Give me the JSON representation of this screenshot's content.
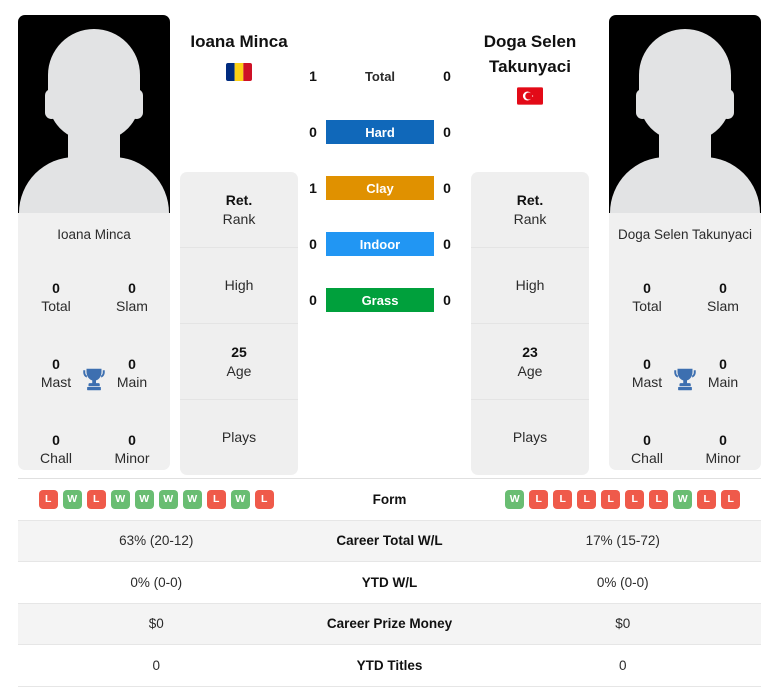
{
  "players": {
    "left": {
      "name": "Ioana Minca",
      "card_name": "Ioana Minca",
      "flag": "romania-flag",
      "titles": {
        "total_val": "0",
        "total_lbl": "Total",
        "slam_val": "0",
        "slam_lbl": "Slam",
        "mast_val": "0",
        "mast_lbl": "Mast",
        "main_val": "0",
        "main_lbl": "Main",
        "chall_val": "0",
        "chall_lbl": "Chall",
        "minor_val": "0",
        "minor_lbl": "Minor"
      },
      "info": {
        "rank_val": "Ret.",
        "rank_lbl": "Rank",
        "high_val": "",
        "high_lbl": "High",
        "age_val": "25",
        "age_lbl": "Age",
        "plays_val": "",
        "plays_lbl": "Plays"
      },
      "form": [
        "L",
        "W",
        "L",
        "W",
        "W",
        "W",
        "W",
        "L",
        "W",
        "L"
      ],
      "career_total_wl": "63% (20-12)",
      "ytd_wl": "0% (0-0)",
      "career_prize_money": "$0",
      "ytd_titles": "0"
    },
    "right": {
      "name": "Doga Selen Takunyaci",
      "card_name": "Doga Selen Takunyaci",
      "flag": "turkey-flag",
      "titles": {
        "total_val": "0",
        "total_lbl": "Total",
        "slam_val": "0",
        "slam_lbl": "Slam",
        "mast_val": "0",
        "mast_lbl": "Mast",
        "main_val": "0",
        "main_lbl": "Main",
        "chall_val": "0",
        "chall_lbl": "Chall",
        "minor_val": "0",
        "minor_lbl": "Minor"
      },
      "info": {
        "rank_val": "Ret.",
        "rank_lbl": "Rank",
        "high_val": "",
        "high_lbl": "High",
        "age_val": "23",
        "age_lbl": "Age",
        "plays_val": "",
        "plays_lbl": "Plays"
      },
      "form": [
        "W",
        "L",
        "L",
        "L",
        "L",
        "L",
        "L",
        "W",
        "L",
        "L"
      ],
      "career_total_wl": "17% (15-72)",
      "ytd_wl": "0% (0-0)",
      "career_prize_money": "$0",
      "ytd_titles": "0"
    }
  },
  "head_to_head": {
    "rows": [
      {
        "label": "Total",
        "left": "1",
        "right": "0",
        "color": "",
        "type": "plain"
      },
      {
        "label": "Hard",
        "left": "0",
        "right": "0",
        "color": "#1068ba",
        "type": "badge"
      },
      {
        "label": "Clay",
        "left": "1",
        "right": "0",
        "color": "#e09100",
        "type": "badge"
      },
      {
        "label": "Indoor",
        "left": "0",
        "right": "0",
        "color": "#2196f3",
        "type": "badge"
      },
      {
        "label": "Grass",
        "left": "0",
        "right": "0",
        "color": "#00a03c",
        "type": "badge"
      }
    ]
  },
  "stats_table": {
    "rows": [
      {
        "label": "Form",
        "key": "form",
        "type": "form",
        "shaded": false
      },
      {
        "label": "Career Total W/L",
        "key": "career_total_wl",
        "type": "text",
        "shaded": true
      },
      {
        "label": "YTD W/L",
        "key": "ytd_wl",
        "type": "text",
        "shaded": false
      },
      {
        "label": "Career Prize Money",
        "key": "career_prize_money",
        "type": "text",
        "shaded": true
      },
      {
        "label": "YTD Titles",
        "key": "ytd_titles",
        "type": "text",
        "shaded": false
      }
    ]
  },
  "colors": {
    "win": "#69bd72",
    "loss": "#ef5a4a",
    "trophy": "#3d6fb0",
    "panel_bg": "#efefef",
    "row_shade": "#f4f4f4"
  }
}
